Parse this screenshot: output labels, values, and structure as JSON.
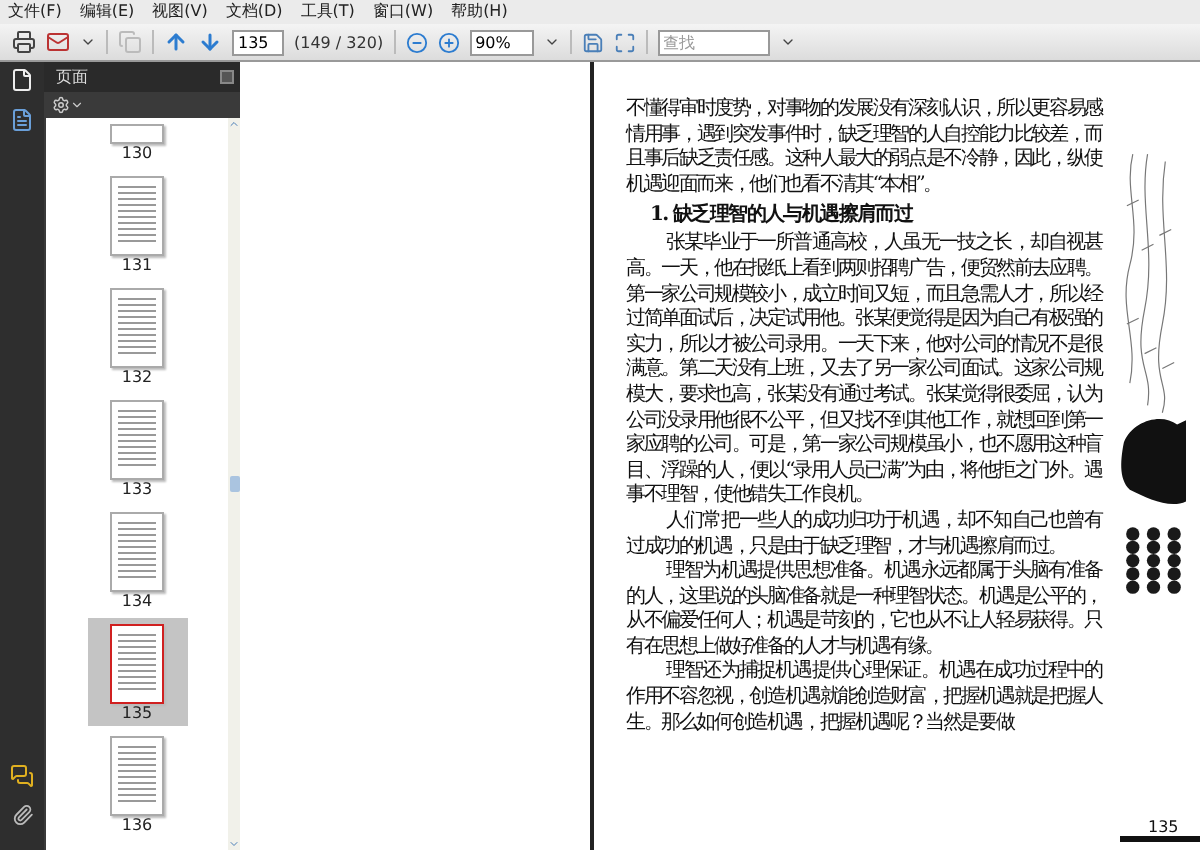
{
  "menu_bar": [
    "文件(F)",
    "编辑(E)",
    "视图(V)",
    "文档(D)",
    "工具(T)",
    "窗口(W)",
    "帮助(H)"
  ],
  "toolbar": {
    "page_field": "135",
    "page_count": "(149 / 320)",
    "zoom_field": "90%",
    "search": {
      "placeholder": "查找"
    }
  },
  "side_panel": {
    "title": "页面",
    "thumbnails": [
      {
        "label": "130",
        "selected": false
      },
      {
        "label": "131",
        "selected": false
      },
      {
        "label": "132",
        "selected": false
      },
      {
        "label": "133",
        "selected": false
      },
      {
        "label": "134",
        "selected": false
      },
      {
        "label": "135",
        "selected": true
      },
      {
        "label": "136",
        "selected": false
      }
    ]
  },
  "document": {
    "paragraphs": [
      {
        "kind": "continued",
        "text": "不懂得审时度势，对事物的发展没有深刻认识，所以更容易感情用事，遇到突发事件时，缺乏理智的人自控能力比较差，而且事后缺乏责任感。这种人最大的弱点是不冷静，因此，纵使机遇迎面而来，他们也看不清其“本相”。"
      },
      {
        "kind": "heading",
        "text": "1. 缺乏理智的人与机遇擦肩而过"
      },
      {
        "kind": "body",
        "text": "张某毕业于一所普通高校，人虽无一技之长，却自视甚高。一天，他在报纸上看到两则招聘广告，便贸然前去应聘。第一家公司规模较小，成立时间又短，而且急需人才，所以经过简单面试后，决定试用他。张某便觉得是因为自己有极强的实力，所以才被公司录用。一天下来，他对公司的情况不是很满意。第二天没有上班，又去了另一家公司面试。这家公司规模大，要求也高，张某没有通过考试。张某觉得很委屈，认为公司没录用他很不公平，但又找不到其他工作，就想回到第一家应聘的公司。可是，第一家公司规模虽小，也不愿用这种盲目、浮躁的人，便以“录用人员已满”为由，将他拒之门外。遇事不理智，使他错失工作良机。"
      },
      {
        "kind": "body",
        "text": "人们常把一些人的成功归功于机遇，却不知自己也曾有过成功的机遇，只是由于缺乏理智，才与机遇擦肩而过。"
      },
      {
        "kind": "body",
        "text": "理智为机遇提供思想准备。机遇永远都属于头脑有准备的人，这里说的头脑准备就是一种理智状态。机遇是公平的，从不偏爱任何人；机遇是苛刻的，它也从不让人轻易获得。只有在思想上做好准备的人才与机遇有缘。"
      },
      {
        "kind": "body",
        "text": "理智还为捕捉机遇提供心理保证。机遇在成功过程中的作用不容忽视，创造机遇就能创造财富，把握机遇就是把握人生。那么如何创造机遇，把握机遇呢？当然是要做"
      }
    ],
    "page_number": "135"
  }
}
